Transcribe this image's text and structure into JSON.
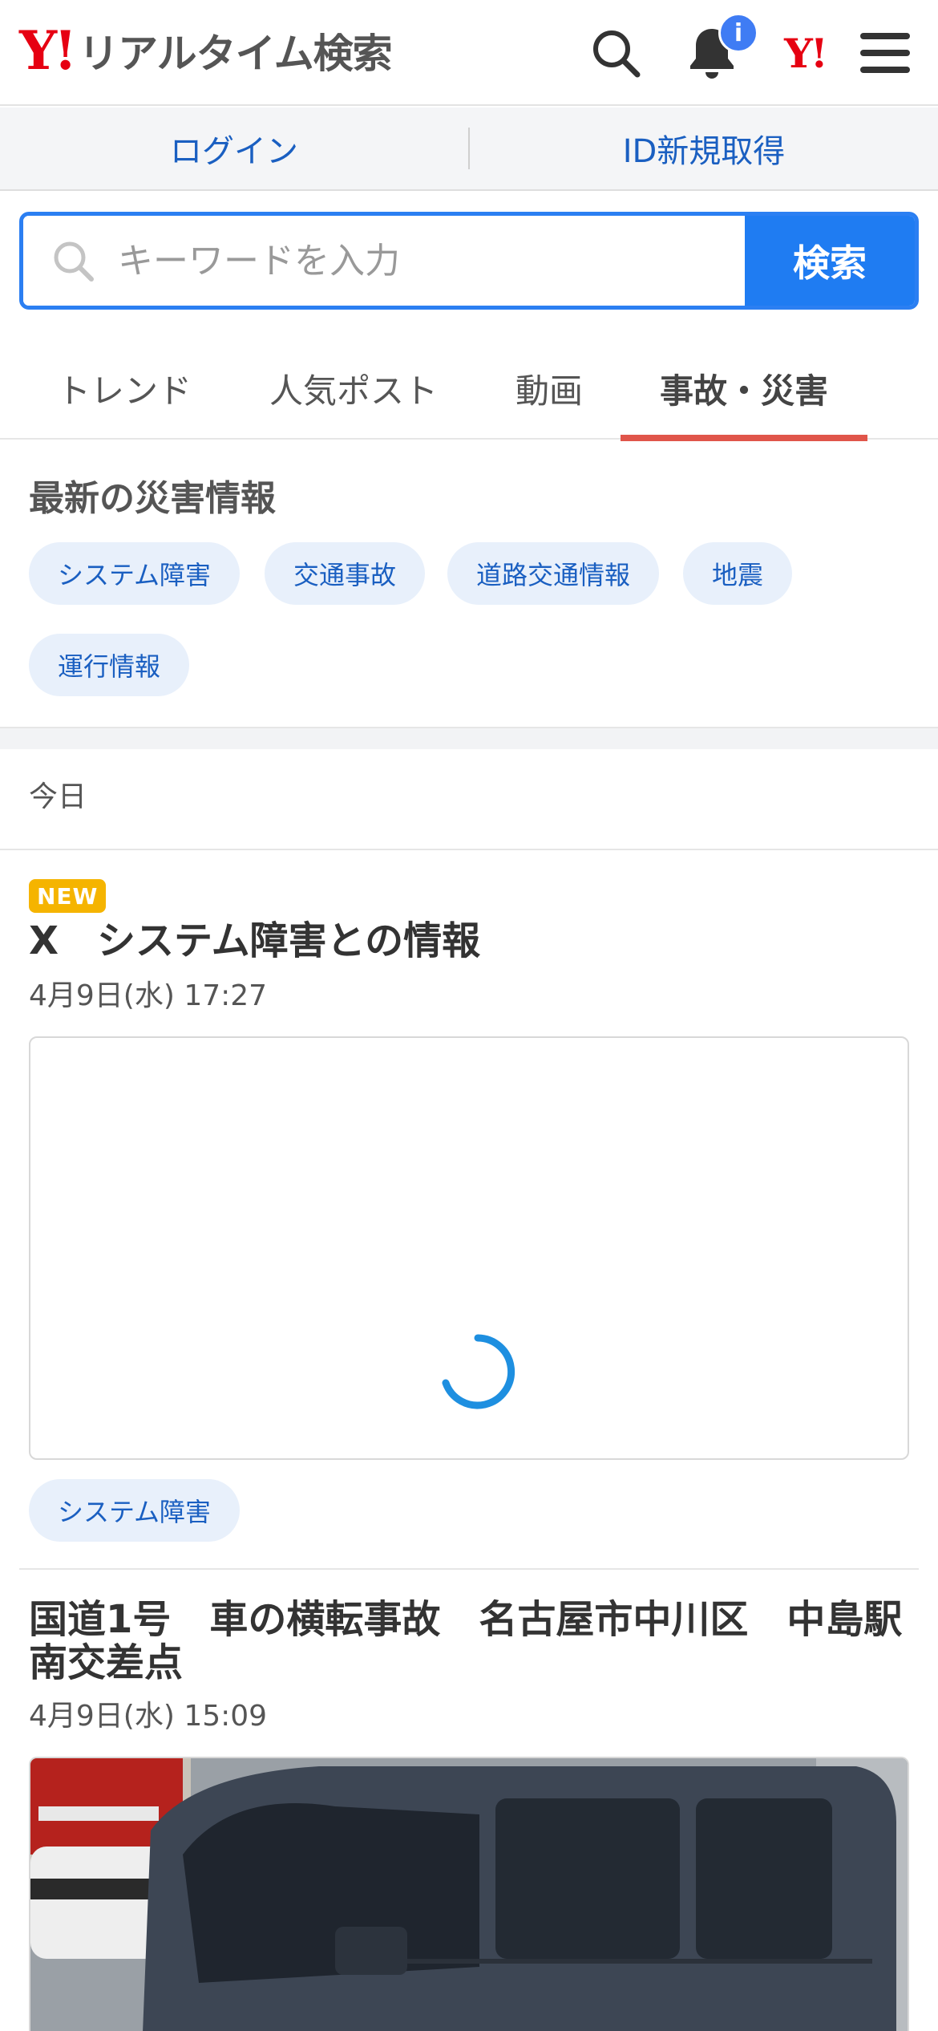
{
  "header": {
    "logo_mark": "Y!",
    "logo_text": "リアルタイム検索",
    "notification_badge": "i",
    "yj_mark": "Y!"
  },
  "loginbar": {
    "login": "ログイン",
    "register": "ID新規取得"
  },
  "search": {
    "placeholder": "キーワードを入力",
    "button": "検索"
  },
  "tabs": [
    {
      "label": "トレンド"
    },
    {
      "label": "人気ポスト"
    },
    {
      "label": "動画"
    },
    {
      "label": "事故・災害",
      "active": true
    }
  ],
  "disaster": {
    "title": "最新の災害情報",
    "chips": [
      "システム障害",
      "交通事故",
      "道路交通情報",
      "地震",
      "運行情報"
    ]
  },
  "section_date": "今日",
  "articles": [
    {
      "badge": "NEW",
      "title": "X　システム障害との情報",
      "date": "4月9日(水) 17:27",
      "tag": "システム障害"
    },
    {
      "title": "国道1号　車の横転事故　名古屋市中川区　中島駅南交差点",
      "date": "4月9日(水) 15:09"
    }
  ],
  "colors": {
    "brand_red": "#e60012",
    "accent_blue": "#1f7cf2",
    "tab_underline": "#e0554a",
    "chip_bg": "#e8f0fb",
    "new_badge": "#f5b400"
  }
}
